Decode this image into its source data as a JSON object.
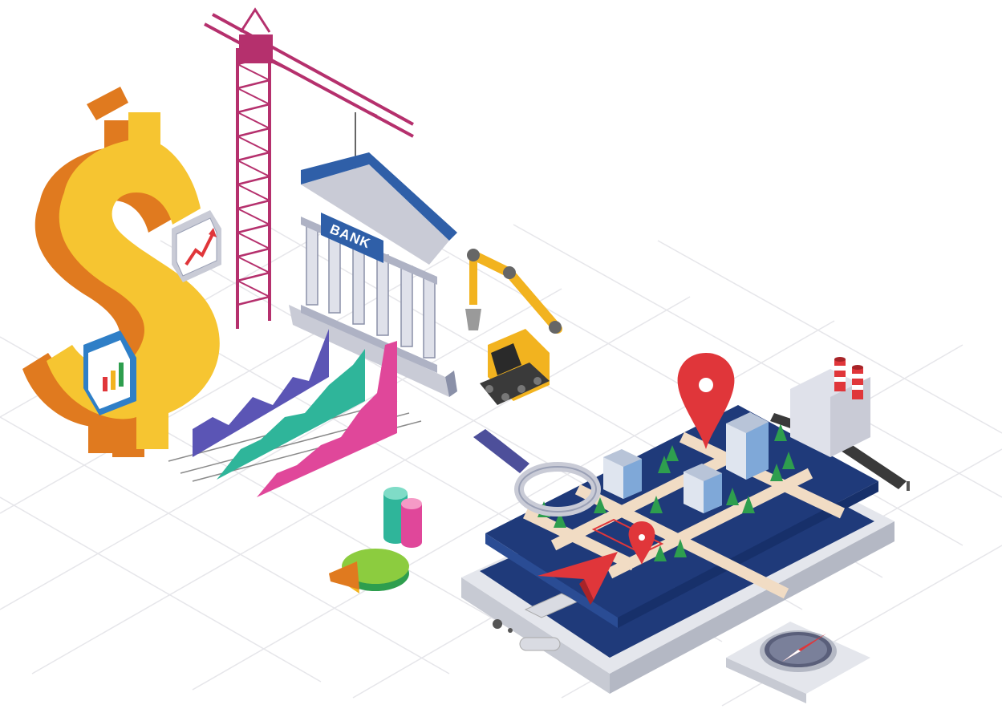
{
  "illustration": {
    "bank_sign": "BANK",
    "icons": [
      "dollar-sign-icon",
      "rising-chart-icon",
      "bar-chart-icon",
      "construction-crane-icon",
      "bank-building-icon",
      "excavator-icon",
      "area-chart-icon",
      "cylinder-chart-icon",
      "pie-chart-icon",
      "magnifying-glass-icon",
      "smartphone-icon",
      "map-pin-icon",
      "navigation-arrow-icon",
      "factory-icon",
      "compass-icon"
    ],
    "colors": {
      "dollar_yellow": "#f6c531",
      "dollar_orange": "#e07a1f",
      "crane_magenta": "#b5306d",
      "bank_blue": "#2f5fa8",
      "bank_gray": "#c9cbd6",
      "excavator_yellow": "#f2b31f",
      "map_navy": "#1f3a7a",
      "map_green": "#2e9e4e",
      "pin_red": "#e0363a",
      "chart_purple": "#5b55b5",
      "chart_teal": "#2fb59a",
      "chart_pink": "#e0479a",
      "grid_line": "#e6e6ea"
    }
  }
}
